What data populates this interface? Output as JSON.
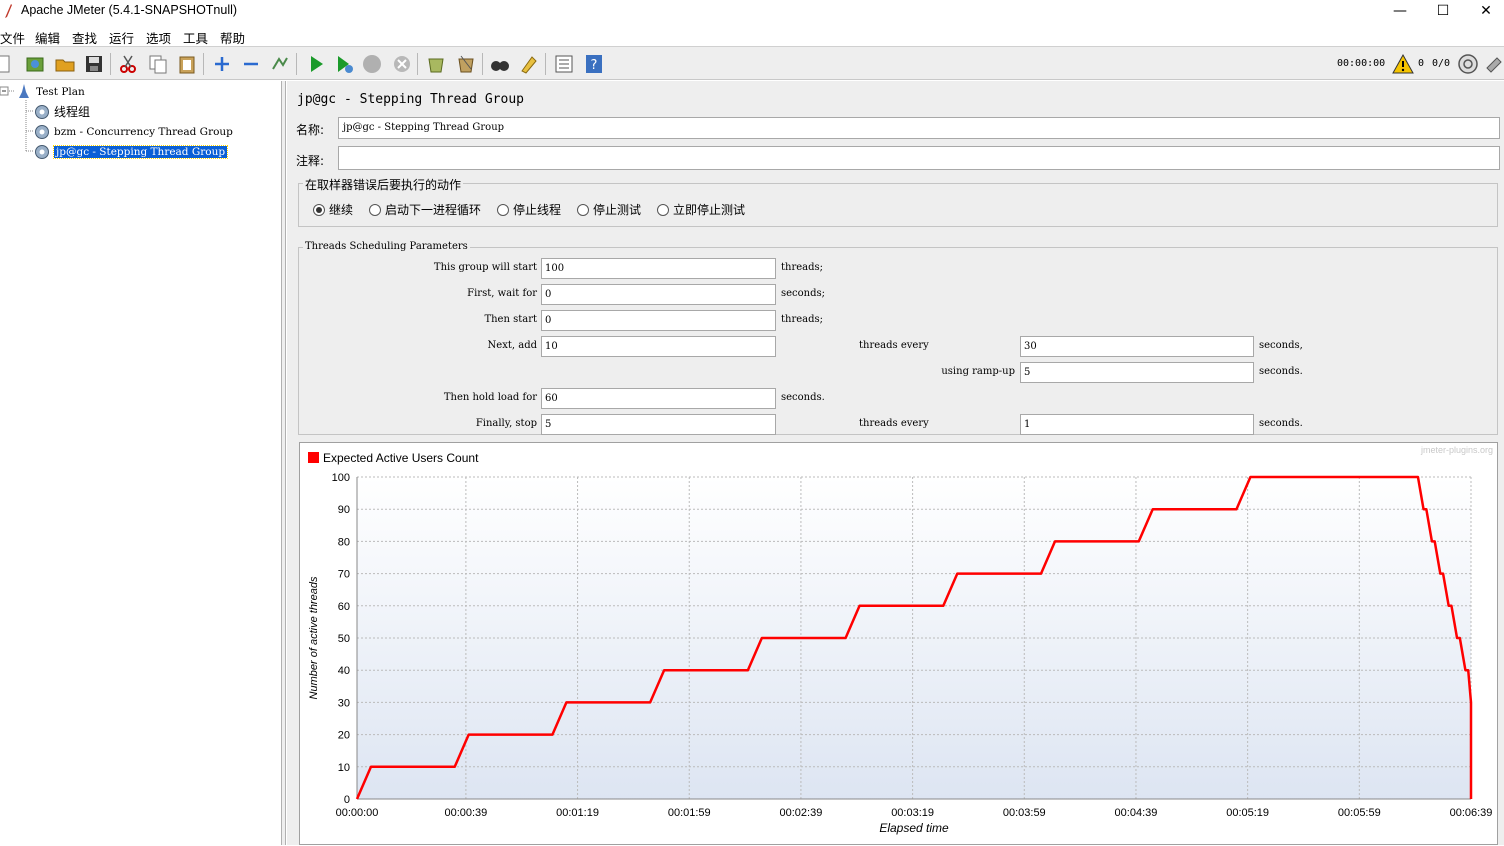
{
  "window": {
    "title": "Apache JMeter (5.4.1-SNAPSHOTnull)",
    "minimize": "—",
    "maximize": "☐",
    "close": "✕"
  },
  "menu": [
    "文件",
    "编辑",
    "查找",
    "运行",
    "选项",
    "工具",
    "帮助"
  ],
  "toolbar": {
    "elapsed": "00:00:00",
    "warnings": "0",
    "threads": "0/0"
  },
  "tree": {
    "root": "Test Plan",
    "items": [
      {
        "label": "线程组",
        "selected": false
      },
      {
        "label": "bzm - Concurrency Thread Group",
        "selected": false
      },
      {
        "label": "jp@gc - Stepping Thread Group",
        "selected": true
      }
    ]
  },
  "panel": {
    "heading": "jp@gc - Stepping Thread Group",
    "name_label": "名称:",
    "name_value": "jp@gc - Stepping Thread Group",
    "comment_label": "注释:",
    "comment_value": "",
    "error_action": {
      "title": "在取样器错误后要执行的动作",
      "options": [
        "继续",
        "启动下一进程循环",
        "停止线程",
        "停止测试",
        "立即停止测试"
      ],
      "selected": 0
    },
    "scheduling": {
      "title": "Threads Scheduling Parameters",
      "start_label": "This group will start",
      "start_value": "100",
      "start_unit": "threads;",
      "wait_label": "First, wait for",
      "wait_value": "0",
      "wait_unit": "seconds;",
      "then_start_label": "Then start",
      "then_start_value": "0",
      "then_start_unit": "threads;",
      "next_add_label": "Next, add",
      "next_add_value": "10",
      "every_label": "threads every",
      "every_value": "30",
      "every_unit": "seconds,",
      "rampup_label": "using ramp-up",
      "rampup_value": "5",
      "rampup_unit": "seconds.",
      "hold_label": "Then hold load for",
      "hold_value": "60",
      "hold_unit": "seconds.",
      "stop_label": "Finally, stop",
      "stop_value": "5",
      "stop_every_label": "threads every",
      "stop_every_value": "1",
      "stop_every_unit": "seconds."
    }
  },
  "chart_data": {
    "type": "line",
    "title": "",
    "watermark": "jmeter-plugins.org",
    "legend": "Expected Active Users Count",
    "legend_color": "#ff0000",
    "xlabel": "Elapsed time",
    "ylabel": "Number of active threads",
    "ylim": [
      0,
      100
    ],
    "yticks": [
      0,
      10,
      20,
      30,
      40,
      50,
      60,
      70,
      80,
      90,
      100
    ],
    "xlim": [
      0,
      399
    ],
    "xtick_values": [
      0,
      39,
      79,
      119,
      159,
      199,
      239,
      279,
      319,
      359,
      399
    ],
    "xtick_labels": [
      "00:00:00",
      "00:00:39",
      "00:01:19",
      "00:01:59",
      "00:02:39",
      "00:03:19",
      "00:03:59",
      "00:04:39",
      "00:05:19",
      "00:05:59",
      "00:06:39"
    ],
    "grid": true,
    "series": [
      {
        "name": "Expected Active Users Count",
        "x": [
          0,
          5,
          35,
          40,
          70,
          75,
          105,
          110,
          140,
          145,
          175,
          180,
          210,
          215,
          245,
          250,
          280,
          285,
          315,
          320,
          380,
          381,
          382,
          383,
          384,
          385,
          386,
          387,
          388,
          389,
          390,
          391,
          392,
          393,
          394,
          395,
          396,
          397,
          398,
          399,
          400
        ],
        "y": [
          0,
          10,
          10,
          20,
          20,
          30,
          30,
          40,
          40,
          50,
          50,
          60,
          60,
          70,
          70,
          80,
          80,
          90,
          90,
          100,
          100,
          95,
          90,
          90,
          85,
          80,
          80,
          75,
          70,
          70,
          65,
          60,
          60,
          55,
          50,
          50,
          45,
          40,
          40,
          30,
          0
        ]
      }
    ]
  }
}
